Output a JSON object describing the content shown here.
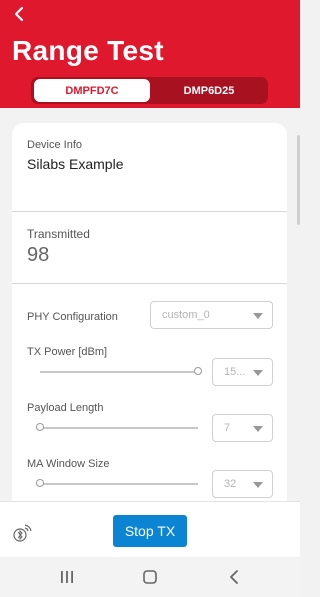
{
  "header": {
    "title": "Range Test",
    "tabs": [
      {
        "label": "DMPFD7C",
        "active": true
      },
      {
        "label": "DMP6D25",
        "active": false
      }
    ]
  },
  "device_info": {
    "label": "Device Info",
    "value": "Silabs Example"
  },
  "transmitted": {
    "label": "Transmitted",
    "value": "98"
  },
  "settings": {
    "phy": {
      "label": "PHY Configuration",
      "value": "custom_0"
    },
    "tx_power": {
      "label": "TX Power [dBm]",
      "value": "15...",
      "slider_fraction": 1.0
    },
    "payload_length": {
      "label": "Payload Length",
      "value": "7",
      "slider_fraction": 0.0
    },
    "ma_window": {
      "label": "MA Window Size",
      "value": "32",
      "slider_fraction": 0.0
    }
  },
  "bottom_bar": {
    "button_label": "Stop TX",
    "icon": "bluetooth-signal-icon"
  },
  "colors": {
    "accent": "#e0182d",
    "button": "#0b84d4"
  }
}
